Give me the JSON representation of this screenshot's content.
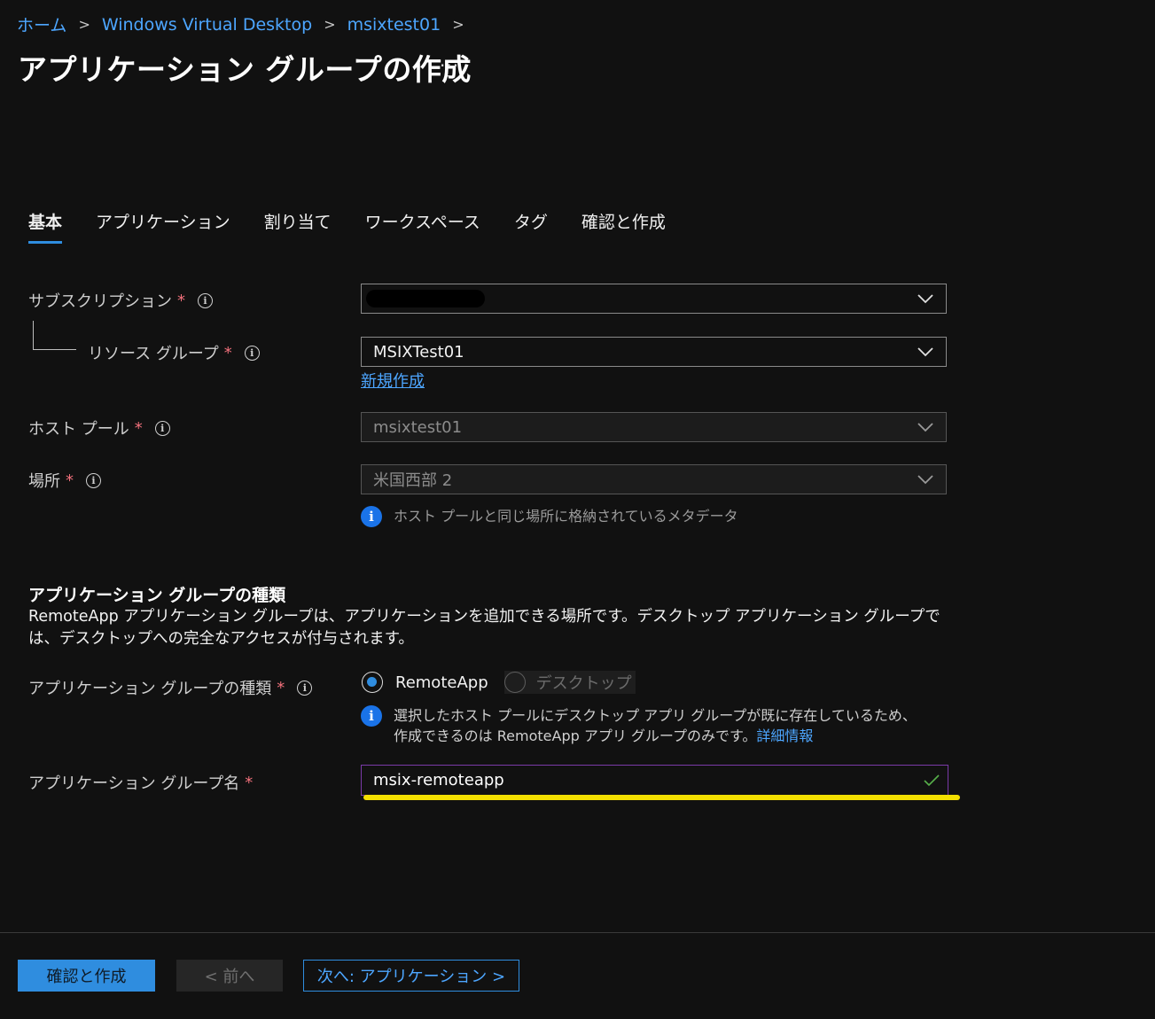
{
  "breadcrumb": [
    "ホーム",
    "Windows Virtual Desktop",
    "msixtest01"
  ],
  "title": "アプリケーション グループの作成",
  "more_label": "···",
  "tabs": [
    "基本",
    "アプリケーション",
    "割り当て",
    "ワークスペース",
    "タグ",
    "確認と作成"
  ],
  "active_tab": "基本",
  "form": {
    "subscription": {
      "label": "サブスクリプション",
      "value": "",
      "redacted": true
    },
    "resource_group": {
      "label": "リソース グループ",
      "value": "MSIXTest01",
      "create_new": "新規作成"
    },
    "host_pool": {
      "label": "ホスト プール",
      "value": "msixtest01"
    },
    "location": {
      "label": "場所",
      "value": "米国西部 2",
      "note": "ホスト プールと同じ場所に格納されているメタデータ"
    },
    "required_mark": "*"
  },
  "group_type": {
    "heading": "アプリケーション グループの種類",
    "description": "RemoteApp アプリケーション グループは、アプリケーションを追加できる場所です。デスクトップ アプリケーション グループでは、デスクトップへの完全なアクセスが付与されます。",
    "label": "アプリケーション グループの種類",
    "options": [
      "RemoteApp",
      "デスクトップ"
    ],
    "selected": "RemoteApp",
    "note": "選択したホスト プールにデスクトップ アプリ グループが既に存在しているため、作成できるのは RemoteApp アプリ グループのみです。",
    "note_link": "詳細情報"
  },
  "group_name": {
    "label": "アプリケーション グループ名",
    "value": "msix-remoteapp"
  },
  "footer": {
    "review_create": "確認と作成",
    "previous": "< 前へ",
    "next": "次へ: アプリケーション >"
  },
  "colors": {
    "accent": "#2f8ddf",
    "link": "#4da6ff",
    "required": "#f1707b",
    "highlight": "#f3df00"
  }
}
